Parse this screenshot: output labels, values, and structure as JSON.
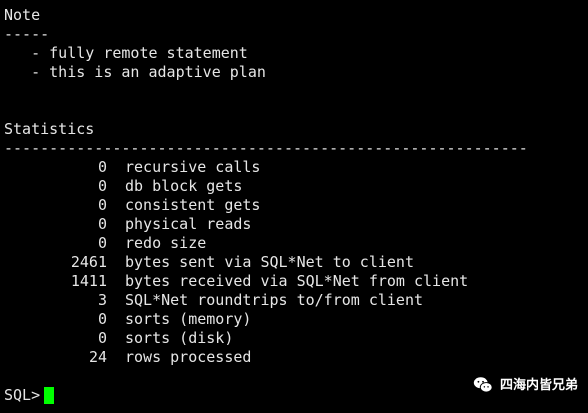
{
  "note": {
    "heading": "Note",
    "underline": "-----",
    "items": [
      "   - fully remote statement",
      "   - this is an adaptive plan"
    ]
  },
  "statistics": {
    "heading": "Statistics",
    "underline": "----------------------------------------------------------",
    "rows": [
      {
        "value": "0",
        "name": "recursive calls"
      },
      {
        "value": "0",
        "name": "db block gets"
      },
      {
        "value": "0",
        "name": "consistent gets"
      },
      {
        "value": "0",
        "name": "physical reads"
      },
      {
        "value": "0",
        "name": "redo size"
      },
      {
        "value": "2461",
        "name": "bytes sent via SQL*Net to client"
      },
      {
        "value": "1411",
        "name": "bytes received via SQL*Net from client"
      },
      {
        "value": "3",
        "name": "SQL*Net roundtrips to/from client"
      },
      {
        "value": "0",
        "name": "sorts (memory)"
      },
      {
        "value": "0",
        "name": "sorts (disk)"
      },
      {
        "value": "24",
        "name": "rows processed"
      }
    ]
  },
  "prompt": {
    "text": "SQL>"
  },
  "watermark": {
    "icon": "wechat-icon",
    "text": "四海内皆兄弟"
  },
  "colors": {
    "background": "#000000",
    "text": "#e6e6e6",
    "cursor": "#00ff00"
  }
}
